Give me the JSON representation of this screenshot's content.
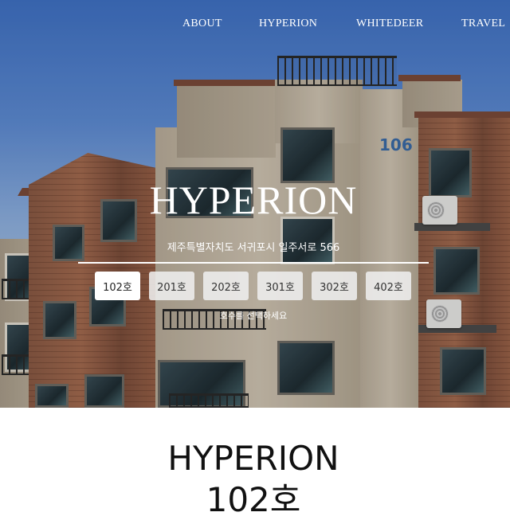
{
  "nav": {
    "items": [
      {
        "label": "ABOUT"
      },
      {
        "label": "HYPERION"
      },
      {
        "label": "WHITEDEER"
      },
      {
        "label": "TRAVEL"
      }
    ]
  },
  "hero": {
    "title": "HYPERION",
    "address": "제주특별자치도 서귀포시 일주서로 566",
    "units": [
      {
        "label": "102호",
        "active": true
      },
      {
        "label": "201호",
        "active": false
      },
      {
        "label": "202호",
        "active": false
      },
      {
        "label": "301호",
        "active": false
      },
      {
        "label": "302호",
        "active": false
      },
      {
        "label": "402호",
        "active": false
      }
    ],
    "hint": "호수를 선택하세요",
    "building_number": "106"
  },
  "main": {
    "title": "HYPERION",
    "unit": "102호"
  }
}
